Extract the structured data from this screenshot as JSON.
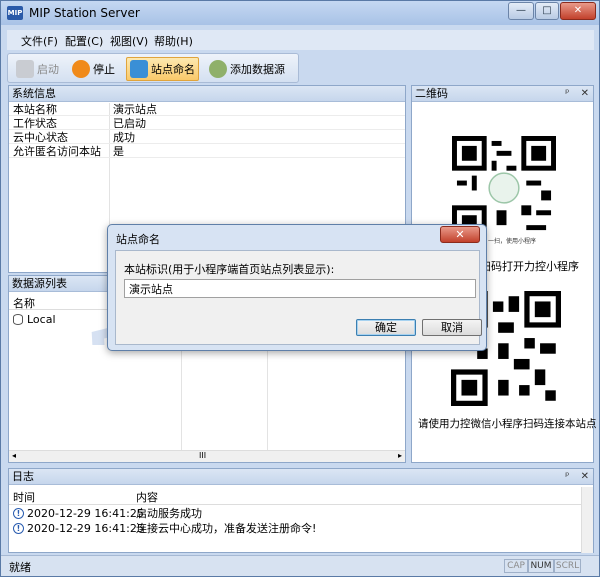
{
  "window": {
    "title": "MIP Station Server",
    "app_icon": "MIP",
    "minimize": "—",
    "maximize": "□",
    "close": "✕"
  },
  "menu": [
    "文件(F)",
    "配置(C)",
    "视图(V)",
    "帮助(H)"
  ],
  "toolbar": {
    "start": "启动",
    "stop": "停止",
    "name_station": "站点命名",
    "add_datasource": "添加数据源"
  },
  "system_info": {
    "title": "系统信息",
    "rows": [
      {
        "key": "本站名称",
        "value": "演示站点"
      },
      {
        "key": "工作状态",
        "value": "已启动"
      },
      {
        "key": "云中心状态",
        "value": "成功"
      },
      {
        "key": "允许匿名访问本站",
        "value": "是"
      }
    ]
  },
  "datasource": {
    "title": "数据源列表",
    "col_name": "名称",
    "items": [
      "Local"
    ],
    "scroll_mark": "III"
  },
  "qrcode": {
    "title": "二维码",
    "pin": "ᵖ",
    "close": "✕",
    "caption1": "扫码打开力控小程序",
    "caption2": "请使用力控微信小程序扫码连接本站点",
    "mini_caption": "一扫，使用小程序"
  },
  "log": {
    "title": "日志",
    "col_time": "时间",
    "col_content": "内容",
    "rows": [
      {
        "time": "2020-12-29 16:41:25",
        "content": "启动服务成功"
      },
      {
        "time": "2020-12-29 16:41:25",
        "content": "连接云中心成功，准备发送注册命令!"
      }
    ]
  },
  "status": {
    "text": "就绪",
    "cap": "CAP",
    "num": "NUM",
    "scrl": "SCRL"
  },
  "dialog": {
    "title": "站点命名",
    "label": "本站标识(用于小程序端首页站点列表显示):",
    "value": "演示站点",
    "ok": "确定",
    "cancel": "取消"
  },
  "watermark": "FORCECON"
}
